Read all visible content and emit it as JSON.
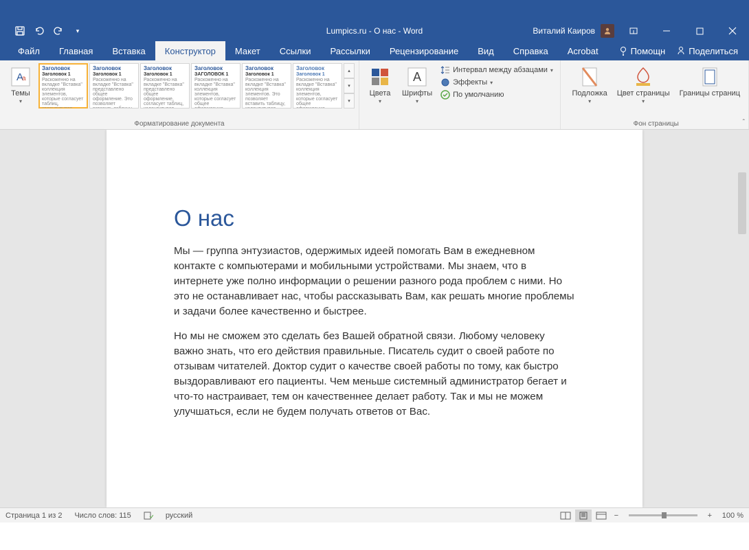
{
  "title": "Lumpics.ru - О нас  -  Word",
  "user": "Виталий Каиров",
  "tabs": {
    "file": "Файл",
    "home": "Главная",
    "insert": "Вставка",
    "design": "Конструктор",
    "layout": "Макет",
    "references": "Ссылки",
    "mailings": "Рассылки",
    "review": "Рецензирование",
    "view": "Вид",
    "help": "Справка",
    "acrobat": "Acrobat",
    "assist": "Помощн",
    "share": "Поделиться"
  },
  "ribbon": {
    "themes": "Темы",
    "gallery_heading": "Заголовок",
    "gallery_heading1": "Заголовок 1",
    "formatting_group": "Форматирование документа",
    "colors": "Цвета",
    "fonts": "Шрифты",
    "spacing": "Интервал между абзацами",
    "effects": "Эффекты",
    "default": "По умолчанию",
    "watermark": "Подложка",
    "page_color": "Цвет страницы",
    "page_borders": "Границы страниц",
    "page_bg_group": "Фон страницы"
  },
  "document": {
    "heading": "О нас",
    "para1": "Мы — группа энтузиастов, одержимых идеей помогать Вам в ежедневном контакте с компьютерами и мобильными устройствами. Мы знаем, что в интернете уже полно информации о решении разного рода проблем с ними. Но это не останавливает нас, чтобы рассказывать Вам, как решать многие проблемы и задачи более качественно и быстрее.",
    "para2": "Но мы не сможем это сделать без Вашей обратной связи. Любому человеку важно знать, что его действия правильные. Писатель судит о своей работе по отзывам читателей. Доктор судит о качестве своей работы по тому, как быстро выздоравливают его пациенты. Чем меньше системный администратор бегает и что-то настраивает, тем он качественнее делает работу. Так и мы не можем улучшаться, если не будем получать ответов от Вас."
  },
  "status": {
    "page": "Страница 1 из 2",
    "words": "Число слов: 115",
    "lang": "русский",
    "zoom": "100 %"
  }
}
